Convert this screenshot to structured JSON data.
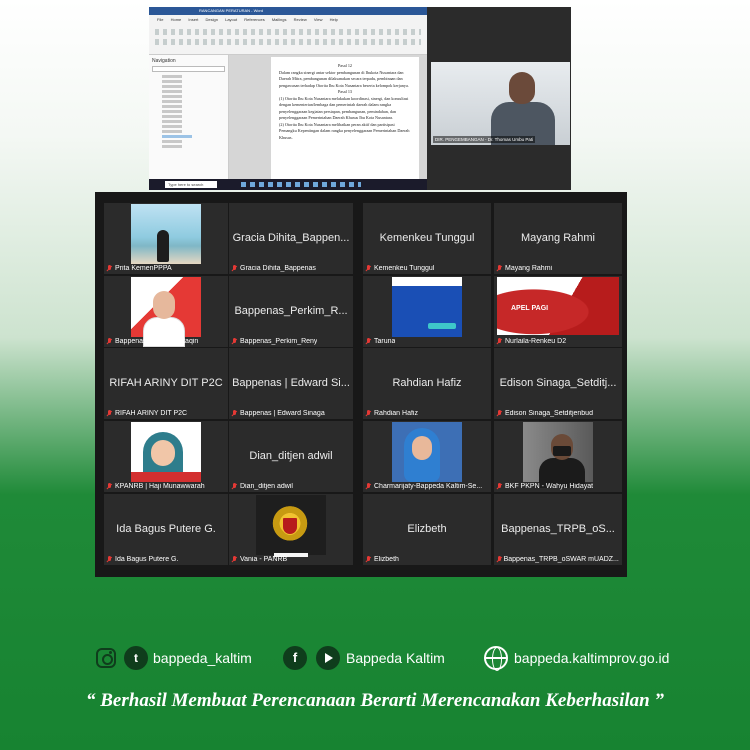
{
  "screen_share": {
    "title_bar": "RANCANGAN PERATURAN - Word",
    "ribbon_tabs": [
      "File",
      "Home",
      "Insert",
      "Design",
      "Layout",
      "References",
      "Mailings",
      "Review",
      "View",
      "Help"
    ],
    "nav_pane_title": "Navigation",
    "doc_heading_1": "Pasal 12",
    "doc_para_1": "Dalam rangka sinergi antar sektor pembangunan di Ibukota Nusantara dan Daerah Mitra, pembangunan dilaksanakan secara terpadu, pembinaan dan pengawasan terhadap Otorita Ibu Kota Nusantara beserta kelompok kerjanya.",
    "doc_heading_2": "Pasal 13",
    "doc_para_2": "(1) Otorita Ibu Kota Nusantara melakukan koordinasi, sinergi, dan konsultasi dengan kementerian/lembaga dan pemerintah daerah dalam rangka penyelenggaraan kegiatan persiapan, pembangunan, pemindahan, dan penyelenggaraan Pemerintahan Daerah Khusus Ibu Kota Nusantara.",
    "doc_para_3": "(2) Otorita Ibu Kota Nusantara melibatkan peran aktif dan partisipasi Pemangku Kepentingan dalam rangka penyelenggaraan Pemerintahan Daerah Khusus.",
    "taskbar_search": "Type here to search",
    "speaker_label": "DIR. PENGEMBANGAN - Dr. Thomas Umbu Pati"
  },
  "participants": [
    {
      "display": "",
      "label": "Prita KemenPPPA",
      "thumb": "beach"
    },
    {
      "display": "Gracia Dihita_Bappen...",
      "label": "Gracia Dihita_Bappenas",
      "thumb": ""
    },
    {
      "display": "Kemenkeu Tunggul",
      "label": "Kemenkeu Tunggul",
      "thumb": ""
    },
    {
      "display": "Mayang Rahmi",
      "label": "Mayang Rahmi",
      "thumb": ""
    },
    {
      "display": "",
      "label": "Bappenas-Tatang Multaqin",
      "thumb": "banner"
    },
    {
      "display": "Bappenas_Perkim_R...",
      "label": "Bappenas_Perkim_Reny",
      "thumb": ""
    },
    {
      "display": "",
      "label": "Taruna",
      "thumb": "blue"
    },
    {
      "display": "",
      "label": "Nurlaila-Renkeu D2",
      "thumb": "apel"
    },
    {
      "display": "RIFAH ARINY DIT P2C",
      "label": "RIFAH ARINY DIT P2C",
      "thumb": ""
    },
    {
      "display": "Bappenas | Edward Si...",
      "label": "Bappenas | Edward Sinaga",
      "thumb": ""
    },
    {
      "display": "Rahdian Hafiz",
      "label": "Rahdian Hafiz",
      "thumb": ""
    },
    {
      "display": "Edison Sinaga_Setditj...",
      "label": "Edison Sinaga_Setditjenbud",
      "thumb": ""
    },
    {
      "display": "",
      "label": "KPANRB | Haji Munawwarah",
      "thumb": "kpan"
    },
    {
      "display": "Dian_ditjen adwil",
      "label": "Dian_ditjen adwil",
      "thumb": ""
    },
    {
      "display": "",
      "label": "Charmarijaty-Bappeda Kaltim-Se...",
      "thumb": "blueh"
    },
    {
      "display": "",
      "label": "BKF PKPN - Wahyu Hidayat",
      "thumb": "room"
    },
    {
      "display": "Ida Bagus Putere G.",
      "label": "Ida Bagus Putere G.",
      "thumb": ""
    },
    {
      "display": "",
      "label": "Vania - PANRB",
      "thumb": "garuda"
    },
    {
      "display": "Elizbeth",
      "label": "Elizbeth",
      "thumb": ""
    },
    {
      "display": "Bappenas_TRPB_oS...",
      "label": "Bappenas_TRPB_oSWAR mUADZ...",
      "thumb": ""
    }
  ],
  "footer": {
    "handle_ig_tw": "bappeda_kaltim",
    "handle_fb_yt": "Bappeda Kaltim",
    "website": "bappeda.kaltimprov.go.id",
    "twitter_glyph": "t",
    "facebook_glyph": "f",
    "tagline": "“ Berhasil  Membuat Perencanaan Berarti Merencanakan Keberhasilan ”"
  },
  "icons": [
    "instagram-icon",
    "twitter-icon",
    "facebook-icon",
    "youtube-icon",
    "globe-icon",
    "mic-muted-icon"
  ],
  "colors": {
    "brand_green": "#1f8a38",
    "tile_bg": "#2b2b2b",
    "muted_mic": "#e53935"
  }
}
